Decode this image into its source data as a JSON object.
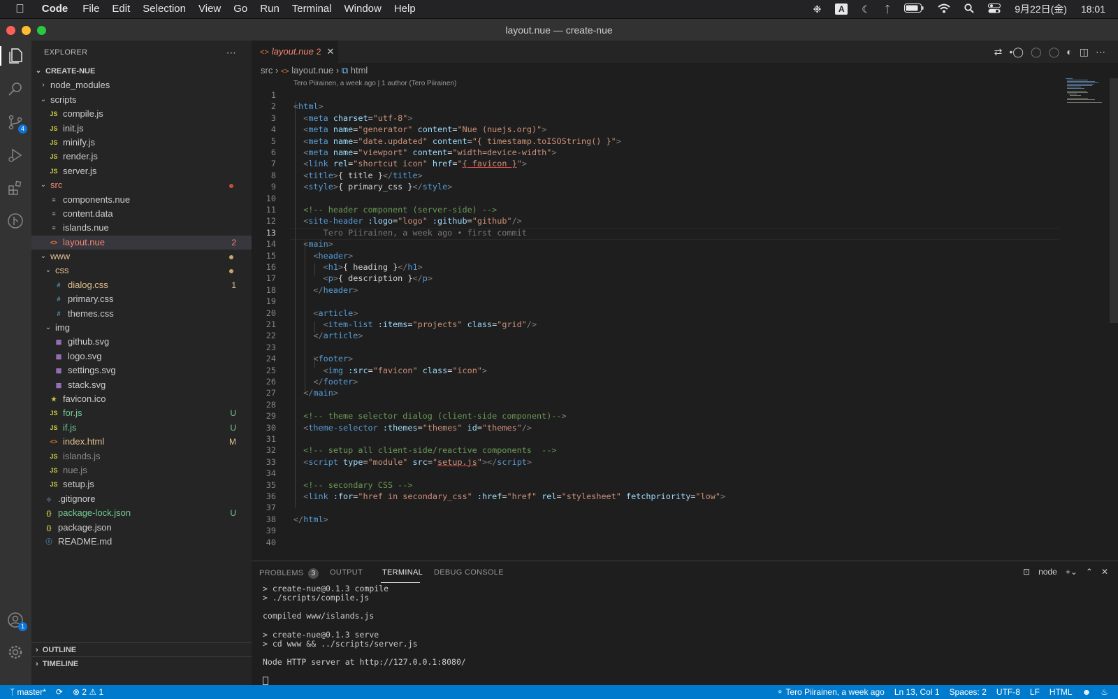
{
  "menubar": {
    "app": "Code",
    "items": [
      "File",
      "Edit",
      "Selection",
      "View",
      "Go",
      "Run",
      "Terminal",
      "Window",
      "Help"
    ],
    "ime": "A",
    "date": "9月22日(金)",
    "time": "18:01"
  },
  "window": {
    "title": "layout.nue — create-nue"
  },
  "activity": {
    "scm_badge": "4",
    "account_badge": "1"
  },
  "sidebar": {
    "title": "EXPLORER",
    "project": "CREATE-NUE",
    "outline": "OUTLINE",
    "timeline": "TIMELINE",
    "tree": [
      {
        "name": "node_modules",
        "type": "folder",
        "open": false,
        "depth": 1,
        "color": "#cccccc"
      },
      {
        "name": "scripts",
        "type": "folder",
        "open": true,
        "depth": 1,
        "color": "#cccccc"
      },
      {
        "name": "compile.js",
        "type": "js",
        "depth": 2,
        "color": "#cccccc"
      },
      {
        "name": "init.js",
        "type": "js",
        "depth": 2,
        "color": "#cccccc"
      },
      {
        "name": "minify.js",
        "type": "js",
        "depth": 2,
        "color": "#cccccc"
      },
      {
        "name": "render.js",
        "type": "js",
        "depth": 2,
        "color": "#cccccc"
      },
      {
        "name": "server.js",
        "type": "js",
        "depth": 2,
        "color": "#cccccc"
      },
      {
        "name": "src",
        "type": "folder",
        "open": true,
        "depth": 1,
        "color": "#f48771",
        "dot": "#c74e39"
      },
      {
        "name": "components.nue",
        "type": "txt",
        "depth": 2,
        "color": "#cccccc"
      },
      {
        "name": "content.data",
        "type": "txt",
        "depth": 2,
        "color": "#cccccc"
      },
      {
        "name": "islands.nue",
        "type": "txt",
        "depth": 2,
        "color": "#cccccc"
      },
      {
        "name": "layout.nue",
        "type": "nue",
        "depth": 2,
        "color": "#f48771",
        "status": "2",
        "statusColor": "#f48771",
        "selected": true
      },
      {
        "name": "www",
        "type": "folder",
        "open": true,
        "depth": 1,
        "color": "#e2c08d",
        "dot": "#c5a86b"
      },
      {
        "name": "css",
        "type": "folder",
        "open": true,
        "depth": 2,
        "color": "#e2c08d",
        "dot": "#c5a86b"
      },
      {
        "name": "dialog.css",
        "type": "css",
        "depth": 3,
        "color": "#e2c08d",
        "status": "1",
        "statusColor": "#e2c08d"
      },
      {
        "name": "primary.css",
        "type": "css",
        "depth": 3,
        "color": "#cccccc"
      },
      {
        "name": "themes.css",
        "type": "css",
        "depth": 3,
        "color": "#cccccc"
      },
      {
        "name": "img",
        "type": "folder",
        "open": true,
        "depth": 2,
        "color": "#cccccc"
      },
      {
        "name": "github.svg",
        "type": "svg",
        "depth": 3,
        "color": "#cccccc"
      },
      {
        "name": "logo.svg",
        "type": "svg",
        "depth": 3,
        "color": "#cccccc"
      },
      {
        "name": "settings.svg",
        "type": "svg",
        "depth": 3,
        "color": "#cccccc"
      },
      {
        "name": "stack.svg",
        "type": "svg",
        "depth": 3,
        "color": "#cccccc"
      },
      {
        "name": "favicon.ico",
        "type": "star",
        "depth": 2,
        "color": "#cccccc"
      },
      {
        "name": "for.js",
        "type": "js",
        "depth": 2,
        "color": "#73c991",
        "status": "U",
        "statusColor": "#73c991"
      },
      {
        "name": "if.js",
        "type": "js",
        "depth": 2,
        "color": "#73c991",
        "status": "U",
        "statusColor": "#73c991"
      },
      {
        "name": "index.html",
        "type": "nue",
        "depth": 2,
        "color": "#e2c08d",
        "status": "M",
        "statusColor": "#e2c08d"
      },
      {
        "name": "islands.js",
        "type": "js",
        "depth": 2,
        "color": "#8c8c8c"
      },
      {
        "name": "nue.js",
        "type": "js",
        "depth": 2,
        "color": "#8c8c8c"
      },
      {
        "name": "setup.js",
        "type": "js",
        "depth": 2,
        "color": "#cccccc"
      },
      {
        "name": ".gitignore",
        "type": "git",
        "depth": 1,
        "color": "#cccccc"
      },
      {
        "name": "package-lock.json",
        "type": "json",
        "depth": 1,
        "color": "#73c991",
        "status": "U",
        "statusColor": "#73c991"
      },
      {
        "name": "package.json",
        "type": "json",
        "depth": 1,
        "color": "#cccccc"
      },
      {
        "name": "README.md",
        "type": "info",
        "depth": 1,
        "color": "#cccccc"
      }
    ]
  },
  "tab": {
    "name": "layout.nue",
    "problems": "2"
  },
  "breadcrumb": {
    "folder": "src",
    "file": "layout.nue",
    "symbol": "html"
  },
  "blame": "Tero Piirainen, a week ago | 1 author (Tero Piirainen)",
  "editor": {
    "current_line": 13,
    "lines": [
      [],
      [
        [
          "t",
          "<"
        ],
        [
          "tn",
          "html"
        ],
        [
          "t",
          ">"
        ]
      ],
      [
        [
          "t",
          "  <"
        ],
        [
          "tn",
          "meta"
        ],
        [
          "p",
          " "
        ],
        [
          "at",
          "charset"
        ],
        [
          "p",
          "="
        ],
        [
          "st",
          "\"utf-8\""
        ],
        [
          "t",
          ">"
        ]
      ],
      [
        [
          "t",
          "  <"
        ],
        [
          "tn",
          "meta"
        ],
        [
          "p",
          " "
        ],
        [
          "at",
          "name"
        ],
        [
          "p",
          "="
        ],
        [
          "st",
          "\"generator\""
        ],
        [
          "p",
          " "
        ],
        [
          "at",
          "content"
        ],
        [
          "p",
          "="
        ],
        [
          "st",
          "\"Nue (nuejs.org)\""
        ],
        [
          "t",
          ">"
        ]
      ],
      [
        [
          "t",
          "  <"
        ],
        [
          "tn",
          "meta"
        ],
        [
          "p",
          " "
        ],
        [
          "at",
          "name"
        ],
        [
          "p",
          "="
        ],
        [
          "st",
          "\"date.updated\""
        ],
        [
          "p",
          " "
        ],
        [
          "at",
          "content"
        ],
        [
          "p",
          "="
        ],
        [
          "st",
          "\"{ timestamp.toISOString() }\""
        ],
        [
          "t",
          ">"
        ]
      ],
      [
        [
          "t",
          "  <"
        ],
        [
          "tn",
          "meta"
        ],
        [
          "p",
          " "
        ],
        [
          "at",
          "name"
        ],
        [
          "p",
          "="
        ],
        [
          "st",
          "\"viewport\""
        ],
        [
          "p",
          " "
        ],
        [
          "at",
          "content"
        ],
        [
          "p",
          "="
        ],
        [
          "st",
          "\"width=device-width\""
        ],
        [
          "t",
          ">"
        ]
      ],
      [
        [
          "t",
          "  <"
        ],
        [
          "tn",
          "link"
        ],
        [
          "p",
          " "
        ],
        [
          "at",
          "rel"
        ],
        [
          "p",
          "="
        ],
        [
          "st",
          "\"shortcut icon\""
        ],
        [
          "p",
          " "
        ],
        [
          "at",
          "href"
        ],
        [
          "p",
          "="
        ],
        [
          "st",
          "\""
        ],
        [
          "stu",
          "{ favicon }"
        ],
        [
          "st",
          "\""
        ],
        [
          "t",
          ">"
        ]
      ],
      [
        [
          "t",
          "  <"
        ],
        [
          "tn",
          "title"
        ],
        [
          "t",
          ">"
        ],
        [
          "p",
          "{ title }"
        ],
        [
          "t",
          "</"
        ],
        [
          "tn",
          "title"
        ],
        [
          "t",
          ">"
        ]
      ],
      [
        [
          "t",
          "  <"
        ],
        [
          "tn",
          "style"
        ],
        [
          "t",
          ">"
        ],
        [
          "p",
          "{ primary_css }"
        ],
        [
          "t",
          "</"
        ],
        [
          "tn",
          "style"
        ],
        [
          "t",
          ">"
        ]
      ],
      [],
      [
        [
          "cm",
          "  <!-- header component (server-side) -->"
        ]
      ],
      [
        [
          "t",
          "  <"
        ],
        [
          "tn",
          "site-header"
        ],
        [
          "p",
          " "
        ],
        [
          "at",
          ":logo"
        ],
        [
          "p",
          "="
        ],
        [
          "st",
          "\"logo\""
        ],
        [
          "p",
          " "
        ],
        [
          "at",
          ":github"
        ],
        [
          "p",
          "="
        ],
        [
          "st",
          "\"github\""
        ],
        [
          "t",
          "/>"
        ]
      ],
      [
        [
          "ph",
          "      Tero Piirainen, a week ago • first commit"
        ]
      ],
      [
        [
          "t",
          "  <"
        ],
        [
          "tn",
          "main"
        ],
        [
          "t",
          ">"
        ]
      ],
      [
        [
          "t",
          "    <"
        ],
        [
          "tn",
          "header"
        ],
        [
          "t",
          ">"
        ]
      ],
      [
        [
          "t",
          "      <"
        ],
        [
          "tn",
          "h1"
        ],
        [
          "t",
          ">"
        ],
        [
          "p",
          "{ heading }"
        ],
        [
          "t",
          "</"
        ],
        [
          "tn",
          "h1"
        ],
        [
          "t",
          ">"
        ]
      ],
      [
        [
          "t",
          "      <"
        ],
        [
          "tn",
          "p"
        ],
        [
          "t",
          ">"
        ],
        [
          "p",
          "{ description }"
        ],
        [
          "t",
          "</"
        ],
        [
          "tn",
          "p"
        ],
        [
          "t",
          ">"
        ]
      ],
      [
        [
          "t",
          "    </"
        ],
        [
          "tn",
          "header"
        ],
        [
          "t",
          ">"
        ]
      ],
      [],
      [
        [
          "t",
          "    <"
        ],
        [
          "tn",
          "article"
        ],
        [
          "t",
          ">"
        ]
      ],
      [
        [
          "t",
          "      <"
        ],
        [
          "tn",
          "item-list"
        ],
        [
          "p",
          " "
        ],
        [
          "at",
          ":items"
        ],
        [
          "p",
          "="
        ],
        [
          "st",
          "\"projects\""
        ],
        [
          "p",
          " "
        ],
        [
          "at",
          "class"
        ],
        [
          "p",
          "="
        ],
        [
          "st",
          "\"grid\""
        ],
        [
          "t",
          "/>"
        ]
      ],
      [
        [
          "t",
          "    </"
        ],
        [
          "tn",
          "article"
        ],
        [
          "t",
          ">"
        ]
      ],
      [],
      [
        [
          "t",
          "    <"
        ],
        [
          "tn",
          "footer"
        ],
        [
          "t",
          ">"
        ]
      ],
      [
        [
          "t",
          "      <"
        ],
        [
          "tn",
          "img"
        ],
        [
          "p",
          " "
        ],
        [
          "at",
          ":src"
        ],
        [
          "p",
          "="
        ],
        [
          "st",
          "\"favicon\""
        ],
        [
          "p",
          " "
        ],
        [
          "at",
          "class"
        ],
        [
          "p",
          "="
        ],
        [
          "st",
          "\"icon\""
        ],
        [
          "t",
          ">"
        ]
      ],
      [
        [
          "t",
          "    </"
        ],
        [
          "tn",
          "footer"
        ],
        [
          "t",
          ">"
        ]
      ],
      [
        [
          "t",
          "  </"
        ],
        [
          "tn",
          "main"
        ],
        [
          "t",
          ">"
        ]
      ],
      [],
      [
        [
          "cm",
          "  <!-- theme selector dialog (client-side component)-->"
        ]
      ],
      [
        [
          "t",
          "  <"
        ],
        [
          "tn",
          "theme-selector"
        ],
        [
          "p",
          " "
        ],
        [
          "at",
          ":themes"
        ],
        [
          "p",
          "="
        ],
        [
          "st",
          "\"themes\""
        ],
        [
          "p",
          " "
        ],
        [
          "at",
          "id"
        ],
        [
          "p",
          "="
        ],
        [
          "st",
          "\"themes\""
        ],
        [
          "t",
          "/>"
        ]
      ],
      [],
      [
        [
          "cm",
          "  <!-- setup all client-side/reactive components  -->"
        ]
      ],
      [
        [
          "t",
          "  <"
        ],
        [
          "tn",
          "script"
        ],
        [
          "p",
          " "
        ],
        [
          "at",
          "type"
        ],
        [
          "p",
          "="
        ],
        [
          "st",
          "\"module\""
        ],
        [
          "p",
          " "
        ],
        [
          "at",
          "src"
        ],
        [
          "p",
          "="
        ],
        [
          "st",
          "\""
        ],
        [
          "stu",
          "setup.js"
        ],
        [
          "st",
          "\""
        ],
        [
          "t",
          "></"
        ],
        [
          "tn",
          "script"
        ],
        [
          "t",
          ">"
        ]
      ],
      [],
      [
        [
          "cm",
          "  <!-- secondary CSS -->"
        ]
      ],
      [
        [
          "t",
          "  <"
        ],
        [
          "tn",
          "link"
        ],
        [
          "p",
          " "
        ],
        [
          "at",
          ":for"
        ],
        [
          "p",
          "="
        ],
        [
          "st",
          "\"href in secondary_css\""
        ],
        [
          "p",
          " "
        ],
        [
          "at",
          ":href"
        ],
        [
          "p",
          "="
        ],
        [
          "st",
          "\"href\""
        ],
        [
          "p",
          " "
        ],
        [
          "at",
          "rel"
        ],
        [
          "p",
          "="
        ],
        [
          "st",
          "\"stylesheet\""
        ],
        [
          "p",
          " "
        ],
        [
          "at",
          "fetchpriority"
        ],
        [
          "p",
          "="
        ],
        [
          "st",
          "\"low\""
        ],
        [
          "t",
          ">"
        ]
      ],
      [],
      [
        [
          "t",
          "</"
        ],
        [
          "tn",
          "html"
        ],
        [
          "t",
          ">"
        ]
      ],
      [],
      []
    ]
  },
  "panel": {
    "tabs": [
      {
        "label": "PROBLEMS",
        "count": "3"
      },
      {
        "label": "OUTPUT"
      },
      {
        "label": "TERMINAL",
        "active": true
      },
      {
        "label": "DEBUG CONSOLE"
      }
    ],
    "shell": "node",
    "terminal": [
      "> create-nue@0.1.3 compile",
      "> ./scripts/compile.js",
      "",
      "compiled www/islands.js",
      "",
      "> create-nue@0.1.3 serve",
      "> cd www && ../scripts/server.js",
      "",
      "Node HTTP server at http://127.0.0.1:8080/"
    ]
  },
  "status": {
    "branch": "master*",
    "errors": "2",
    "warnings": "1",
    "blame": "Tero Piirainen, a week ago",
    "position": "Ln 13, Col 1",
    "spaces": "Spaces: 2",
    "encoding": "UTF-8",
    "eol": "LF",
    "language": "HTML"
  }
}
